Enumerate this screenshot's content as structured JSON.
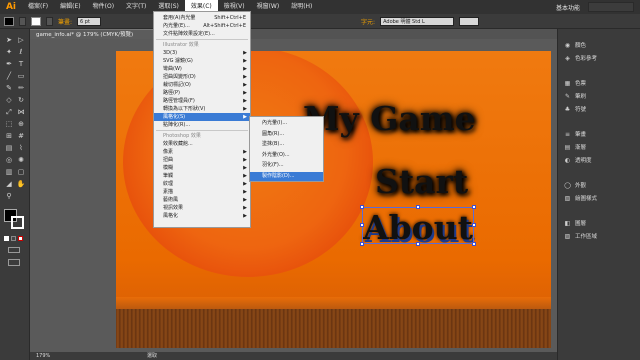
{
  "app": {
    "logo": "Ai"
  },
  "menubar": {
    "items": [
      "檔案(F)",
      "編輯(E)",
      "物件(O)",
      "文字(T)",
      "選取(S)",
      "效果(C)",
      "檢視(V)",
      "視窗(W)",
      "說明(H)"
    ],
    "active_index": 5,
    "workspace_label": "基本功能"
  },
  "controlbar": {
    "stroke_label": "筆畫:",
    "stroke_value": "6 pt",
    "char_label": "字元:",
    "font_value": "Adobe 明體 Std L",
    "fill_color": "#000000"
  },
  "document": {
    "tab_label": "game_info.ai* @ 179% (CMYK/預覽)"
  },
  "artboard": {
    "title_text": "My Game",
    "start_text": "Start",
    "about_text": "About"
  },
  "effect_menu": {
    "items": [
      {
        "label": "套用(A)內光暈",
        "shortcut": "Shift+Ctrl+E"
      },
      {
        "label": "內光暈(E)...",
        "shortcut": "Alt+Shift+Ctrl+E"
      },
      {
        "label": "文件點陣效果設定(E)...",
        "shortcut": ""
      },
      {
        "label": "Illustrator 效果",
        "header": true
      },
      {
        "label": "3D(3)",
        "submenu": true
      },
      {
        "label": "SVG 濾鏡(G)",
        "submenu": true
      },
      {
        "label": "彎曲(W)",
        "submenu": true
      },
      {
        "label": "扭曲與變形(D)",
        "submenu": true
      },
      {
        "label": "裁切標記(O)",
        "submenu": true
      },
      {
        "label": "路徑(P)",
        "submenu": true
      },
      {
        "label": "路徑管理員(F)",
        "submenu": true
      },
      {
        "label": "轉換為以下形狀(V)",
        "submenu": true
      },
      {
        "label": "風格化(S)",
        "submenu": true,
        "highlight": true
      },
      {
        "label": "點陣化(R)...",
        "submenu": false
      },
      {
        "label": "Photoshop 效果",
        "header": true
      },
      {
        "label": "效果收藏館...",
        "submenu": false
      },
      {
        "label": "像素",
        "submenu": true
      },
      {
        "label": "扭曲",
        "submenu": true
      },
      {
        "label": "模糊",
        "submenu": true
      },
      {
        "label": "筆觸",
        "submenu": true
      },
      {
        "label": "紋理",
        "submenu": true
      },
      {
        "label": "素描",
        "submenu": true
      },
      {
        "label": "藝術風",
        "submenu": true
      },
      {
        "label": "視訊效果",
        "submenu": true
      },
      {
        "label": "風格化",
        "submenu": true
      }
    ]
  },
  "stylize_submenu": {
    "items": [
      "內光暈(I)...",
      "圓角(R)...",
      "塗抹(B)...",
      "外光暈(O)...",
      "羽化(F)...",
      "製作陰影(D)..."
    ],
    "highlight_index": 5
  },
  "panels": {
    "groups": [
      [
        "顏色",
        "色彩參考"
      ],
      [
        "色票",
        "筆刷",
        "符號"
      ],
      [
        "筆畫",
        "漸層",
        "透明度"
      ],
      [
        "外觀",
        "繪圖樣式"
      ],
      [
        "圖層",
        "工作區域"
      ]
    ]
  },
  "statusbar": {
    "zoom": "179%",
    "tool_label": "選取"
  }
}
